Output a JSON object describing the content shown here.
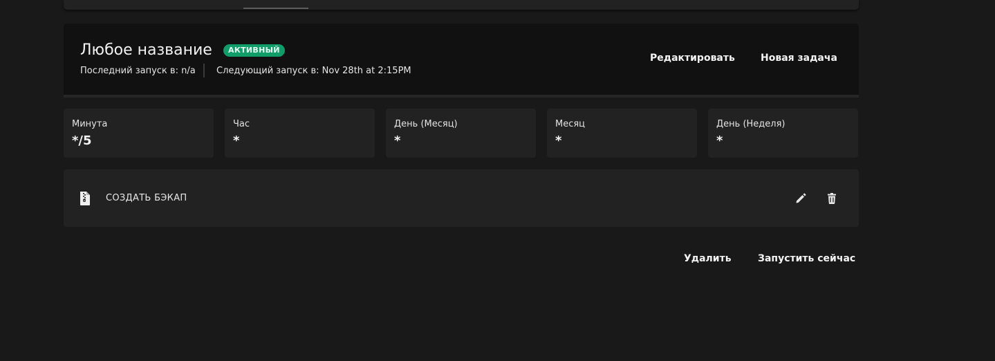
{
  "header": {
    "title": "Любое название",
    "status_badge": "АКТИВНЫЙ",
    "last_run": "Последний запуск в: n/a",
    "next_run": "Следующий запуск в: Nov 28th at 2:15PM",
    "edit_label": "Редактировать",
    "new_task_label": "Новая задача"
  },
  "cron": [
    {
      "label": "Минута",
      "value": "*/5"
    },
    {
      "label": "Час",
      "value": "*"
    },
    {
      "label": "День (Месяц)",
      "value": "*"
    },
    {
      "label": "Месяц",
      "value": "*"
    },
    {
      "label": "День (Неделя)",
      "value": "*"
    }
  ],
  "tasks": [
    {
      "icon": "file-archive-icon",
      "label": "СОЗДАТЬ БЭКАП"
    }
  ],
  "footer": {
    "delete_label": "Удалить",
    "run_now_label": "Запустить сейчас"
  },
  "colors": {
    "background": "#191919",
    "card": "#222222",
    "header_card": "#111111",
    "badge_active": "#0f9d6a"
  }
}
